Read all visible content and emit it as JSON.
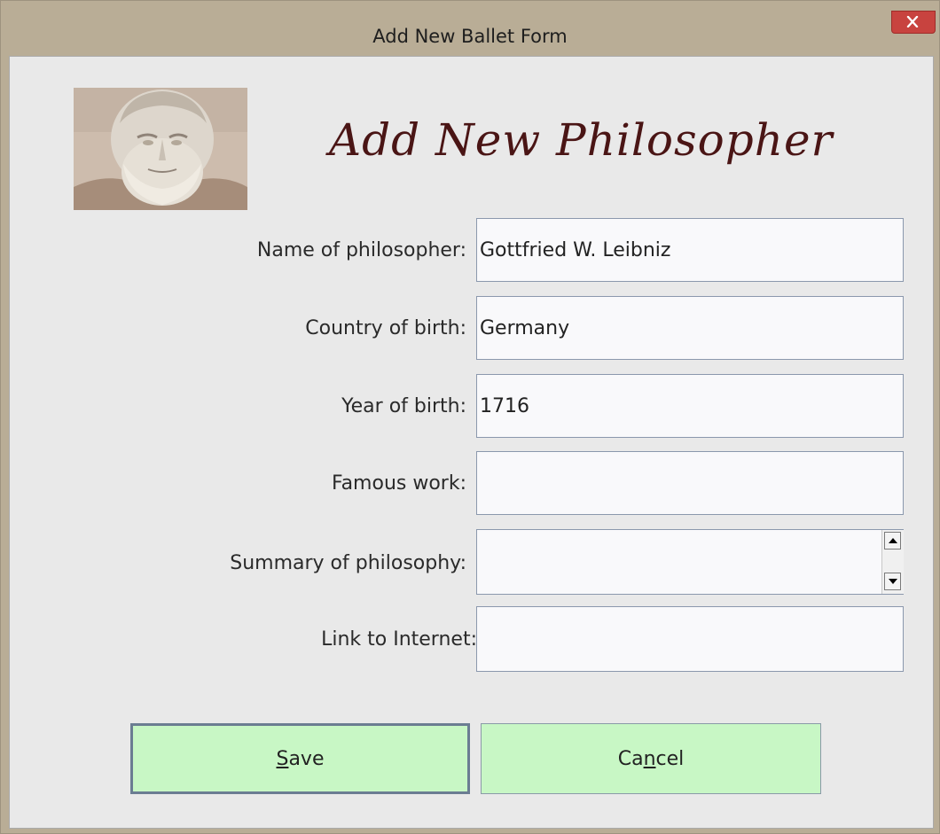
{
  "window": {
    "title": "Add New Ballet Form",
    "close_icon": "close-icon"
  },
  "header": {
    "title": "Add New Philosopher",
    "portrait_icon": "philosopher-bust-image"
  },
  "form": {
    "name_label": "Name of philosopher:",
    "name_value": "Gottfried W. Leibniz",
    "country_label": "Country of birth:",
    "country_value": "Germany",
    "year_label": "Year of birth:",
    "year_value": "1716",
    "work_label": "Famous work:",
    "work_value": "",
    "summary_label": "Summary of philosophy:",
    "summary_value": "",
    "link_label": "Link to Internet:",
    "link_value": ""
  },
  "buttons": {
    "save_label": "Save",
    "save_mnemonic": "S",
    "save_rest": "ave",
    "cancel_label": "Cancel",
    "cancel_pre": "Ca",
    "cancel_mnemonic": "n",
    "cancel_post": "cel"
  },
  "colors": {
    "button_bg": "#c8f7c5",
    "title_bar": "#b9ad96",
    "close_button": "#c8433f",
    "heading": "#4a1515"
  }
}
